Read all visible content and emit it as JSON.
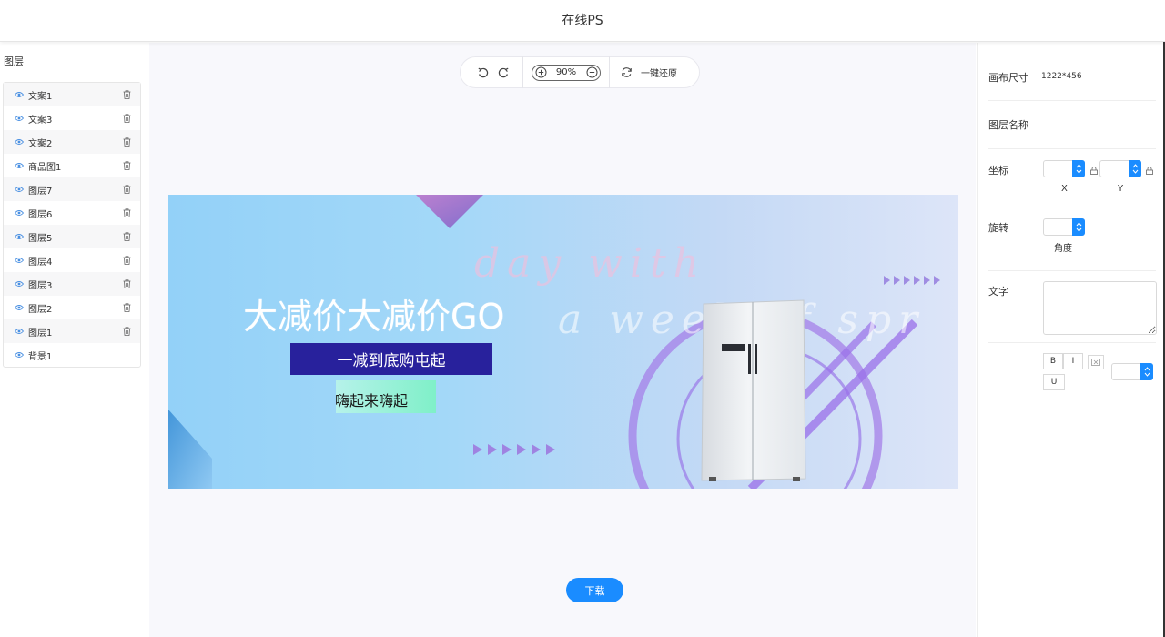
{
  "app": {
    "title": "在线PS"
  },
  "layers": {
    "title": "图层",
    "items": [
      {
        "label": "文案1"
      },
      {
        "label": "文案3"
      },
      {
        "label": "文案2"
      },
      {
        "label": "商品图1"
      },
      {
        "label": "图层7"
      },
      {
        "label": "图层6"
      },
      {
        "label": "图层5"
      },
      {
        "label": "图层4"
      },
      {
        "label": "图层3"
      },
      {
        "label": "图层2"
      },
      {
        "label": "图层1"
      },
      {
        "label": "背景1"
      }
    ]
  },
  "toolbar": {
    "zoom": "90%",
    "reset_label": "一键还原"
  },
  "banner": {
    "headline": "大减价大减价GO",
    "subtitle": "一减到底购屯起",
    "tagline": "嗨起来嗨起",
    "script_line1": "day with",
    "script_line2": "a week of spr"
  },
  "download_label": "下载",
  "properties": {
    "canvas_size_label": "画布尺寸",
    "canvas_size_value": "1222*456",
    "layer_name_label": "图层名称",
    "position_label": "坐标",
    "x_label": "X",
    "y_label": "Y",
    "rotation_label": "旋转",
    "angle_label": "角度",
    "text_label": "文字",
    "bold": "B",
    "italic": "I",
    "underline": "U"
  },
  "colors": {
    "accent": "#1a8cff",
    "subtitle_bg": "#28219c",
    "canvas_bg": "#f8f8fc"
  }
}
